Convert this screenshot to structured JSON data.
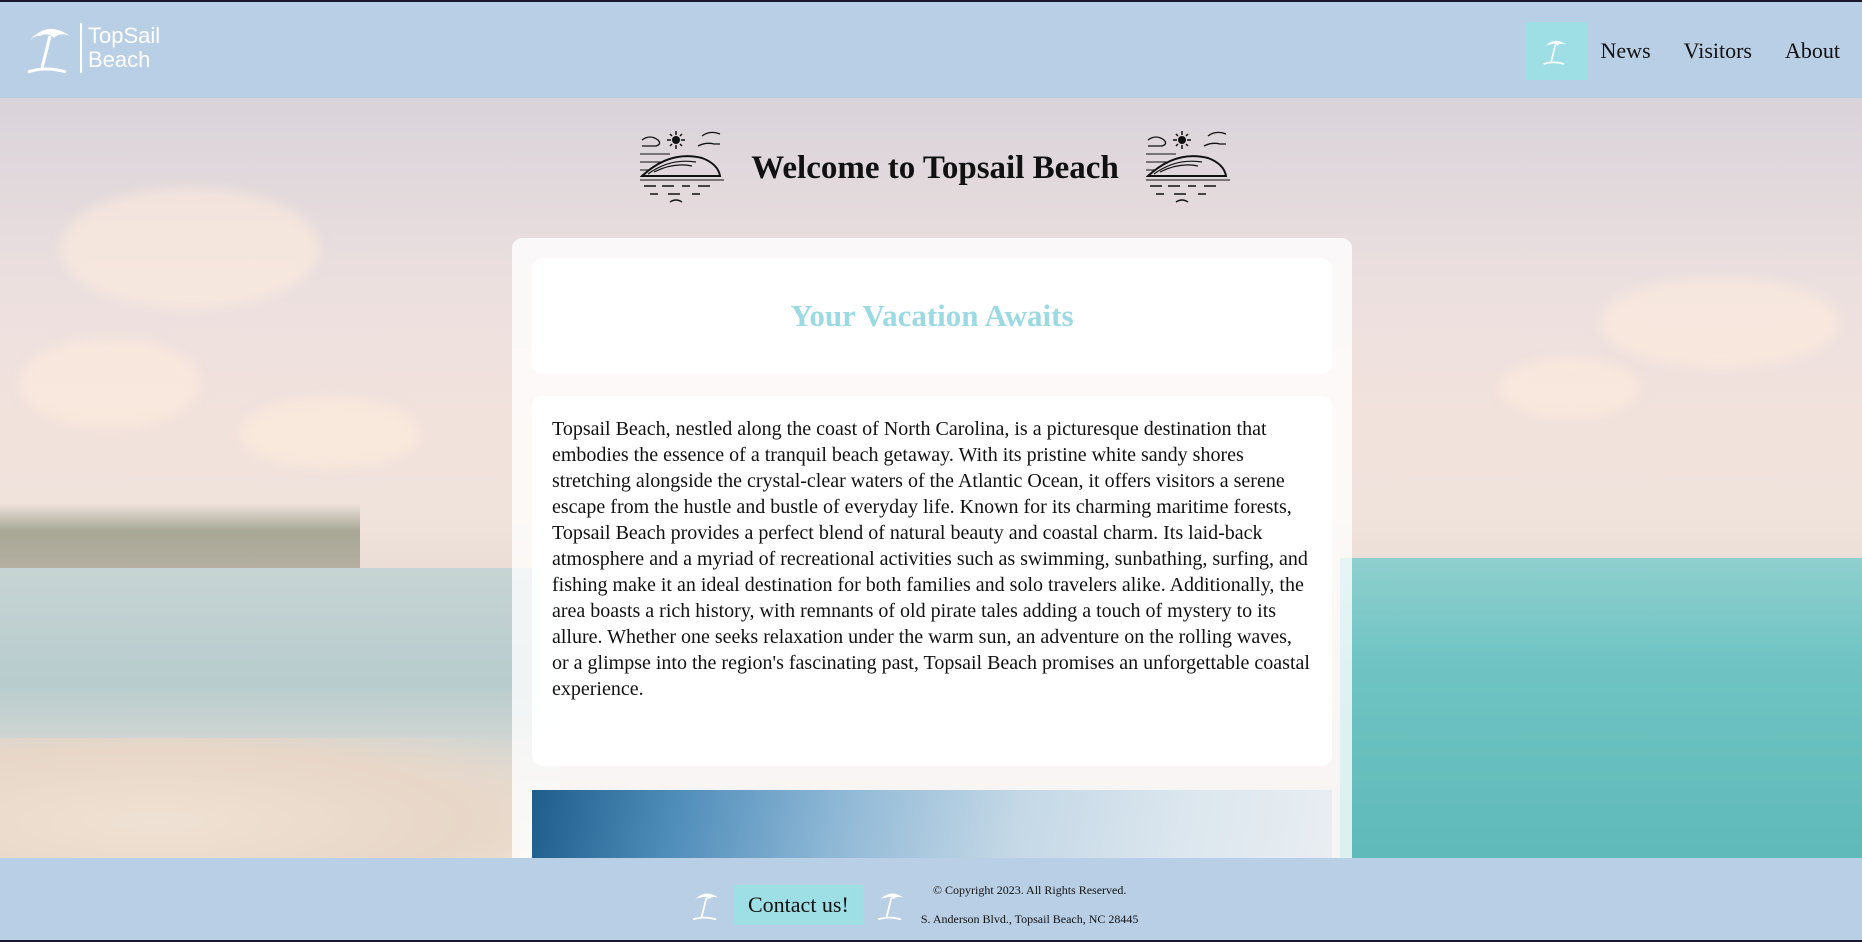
{
  "header": {
    "logo": {
      "line1": "TopSail",
      "line2": "Beach",
      "icon": "palm-umbrella-icon"
    },
    "nav": {
      "home_icon": "palm-umbrella-icon",
      "links": [
        {
          "label": "News"
        },
        {
          "label": "Visitors"
        },
        {
          "label": "About"
        }
      ]
    }
  },
  "welcome": {
    "title": "Welcome to Topsail Beach",
    "icon": "beach-wave-icon"
  },
  "card": {
    "title": "Your Vacation Awaits",
    "body": "Topsail Beach, nestled along the coast of North Carolina, is a picturesque destination that embodies the essence of a tranquil beach getaway. With its pristine white sandy shores stretching alongside the crystal-clear waters of the Atlantic Ocean, it offers visitors a serene escape from the hustle and bustle of everyday life. Known for its charming maritime forests, Topsail Beach provides a perfect blend of natural beauty and coastal charm. Its laid-back atmosphere and a myriad of recreational activities such as swimming, sunbathing, surfing, and fishing make it an ideal destination for both families and solo travelers alike. Additionally, the area boasts a rich history, with remnants of old pirate tales adding a touch of mystery to its allure. Whether one seeks relaxation under the warm sun, an adventure on the rolling waves, or a glimpse into the region's fascinating past, Topsail Beach promises an unforgettable coastal experience."
  },
  "footer": {
    "contact_label": "Contact us!",
    "copyright": "© Copyright 2023. All Rights Reserved.",
    "address": "S. Anderson Blvd., Topsail Beach, NC 28445"
  },
  "colors": {
    "header_bg": "#b9cfe5",
    "accent": "#9edfe6",
    "card_title": "#9bd9e3"
  }
}
